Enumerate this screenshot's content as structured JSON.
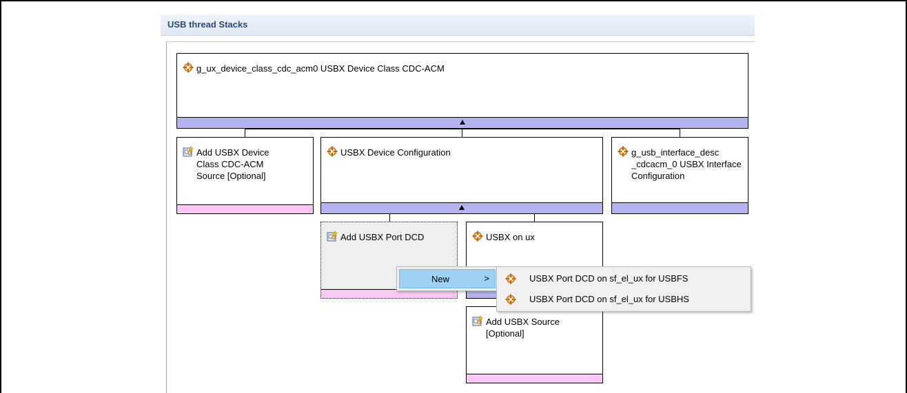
{
  "header": {
    "title": "USB thread Stacks"
  },
  "boxes": {
    "top": {
      "title": "g_ux_device_class_cdc_acm0 USBX Device Class CDC-ACM",
      "icon": "module-icon"
    },
    "add_cdc_source": {
      "title": "Add USBX Device Class CDC-ACM Source [Optional]",
      "icon": "add-module-icon"
    },
    "device_config": {
      "title": "USBX Device Configuration",
      "icon": "module-icon"
    },
    "interface_config": {
      "title": "g_usb_interface_desc _cdcacm_0 USBX Interface Configuration",
      "icon": "module-icon"
    },
    "add_port_dcd": {
      "title": "Add USBX Port DCD",
      "icon": "add-module-icon"
    },
    "usbx_on_ux": {
      "title": "USBX on ux",
      "icon": "module-icon"
    },
    "add_usbx_source": {
      "title": "Add USBX Source [Optional]",
      "icon": "add-module-icon"
    }
  },
  "context_menu": {
    "new_label": "New",
    "arrow": ">",
    "items": [
      {
        "label": "USBX Port DCD on sf_el_ux for USBFS",
        "icon": "module-icon"
      },
      {
        "label": "USBX Port DCD on sf_el_ux for USBHS",
        "icon": "module-icon"
      }
    ]
  },
  "colors": {
    "bar_blue": "#b3b3ef",
    "bar_pink": "#fdc7f5",
    "menu_highlight": "#9fd1f5",
    "header_text": "#2b4a7a"
  }
}
